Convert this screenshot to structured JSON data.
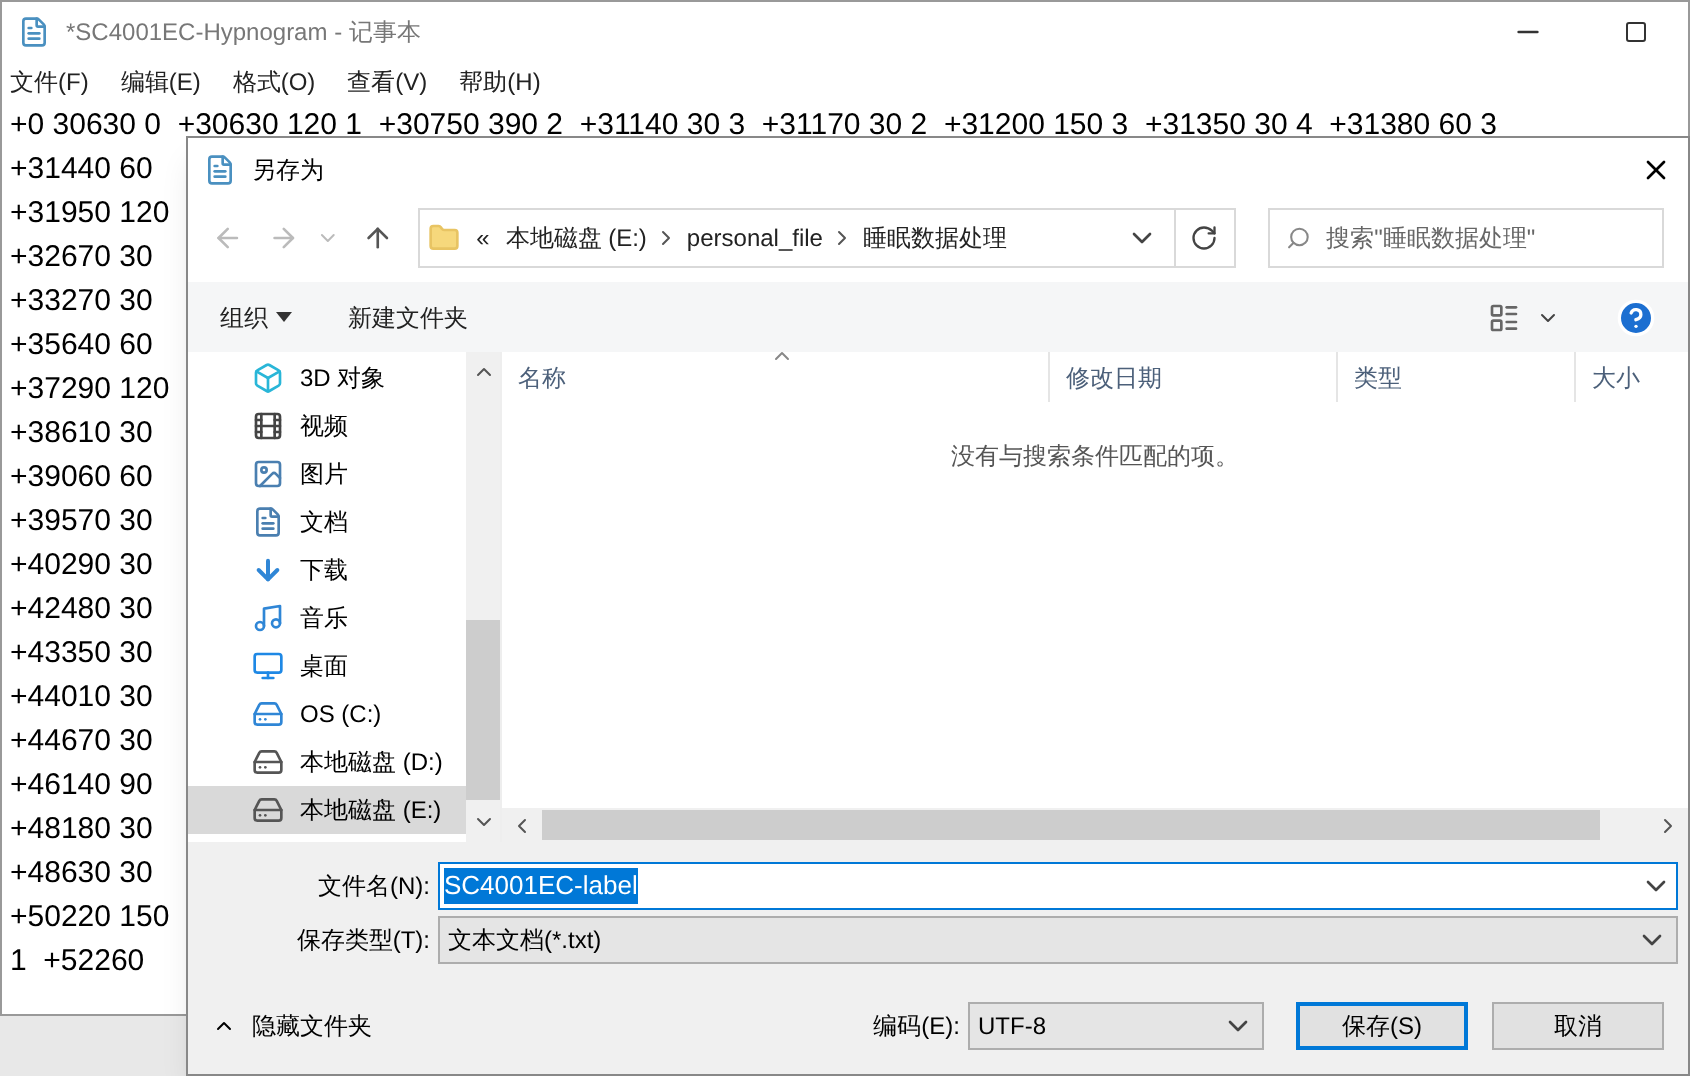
{
  "notepad": {
    "title": "*SC4001EC-Hypnogram - 记事本",
    "menu": [
      "文件(F)",
      "编辑(E)",
      "格式(O)",
      "查看(V)",
      "帮助(H)"
    ],
    "lines": [
      "+0 30630 0  +30630 120 1  +30750 390 2  +31140 30 3  +31170 30 2  +31200 150 3  +31350 30 4  +31380 60 3",
      "+31440 60",
      "+31950 120",
      "+32670 30",
      "+33270 30",
      "+35640 60",
      "+37290 120",
      "+38610 30",
      "+39060 60",
      "+39570 30",
      "+40290 30",
      "+42480 30",
      "+43350 30",
      "+44010 30",
      "+44670 30",
      "+46140 90",
      "+48180 30",
      "+48630 30",
      "+50220 150",
      "1  +52260"
    ]
  },
  "dialog": {
    "title": "另存为",
    "breadcrumb": [
      "«",
      "本地磁盘 (E:)",
      "personal_file",
      "睡眠数据处理"
    ],
    "search": {
      "placeholder": "搜索\"睡眠数据处理\""
    },
    "toolbar": {
      "organize": "组织",
      "new_folder": "新建文件夹"
    },
    "nav": [
      {
        "kind": "objects3d",
        "label": "3D 对象",
        "selected": false
      },
      {
        "kind": "videos",
        "label": "视频",
        "selected": false
      },
      {
        "kind": "pictures",
        "label": "图片",
        "selected": false
      },
      {
        "kind": "documents",
        "label": "文档",
        "selected": false
      },
      {
        "kind": "downloads",
        "label": "下载",
        "selected": false
      },
      {
        "kind": "music",
        "label": "音乐",
        "selected": false
      },
      {
        "kind": "desktop",
        "label": "桌面",
        "selected": false
      },
      {
        "kind": "system_drive",
        "label": "OS (C:)",
        "selected": false
      },
      {
        "kind": "drive",
        "label": "本地磁盘 (D:)",
        "selected": false
      },
      {
        "kind": "drive",
        "label": "本地磁盘 (E:)",
        "selected": true
      }
    ],
    "columns": [
      "名称",
      "修改日期",
      "类型",
      "大小"
    ],
    "empty_message": "没有与搜索条件匹配的项。",
    "file_name": {
      "label": "文件名(N):",
      "value": "SC4001EC-label"
    },
    "file_type": {
      "label": "保存类型(T):",
      "value": "文本文档(*.txt)"
    },
    "hide_folders": "隐藏文件夹",
    "encoding": {
      "label": "编码(E):",
      "value": "UTF-8"
    },
    "buttons": [
      "保存(S)",
      "取消"
    ]
  }
}
